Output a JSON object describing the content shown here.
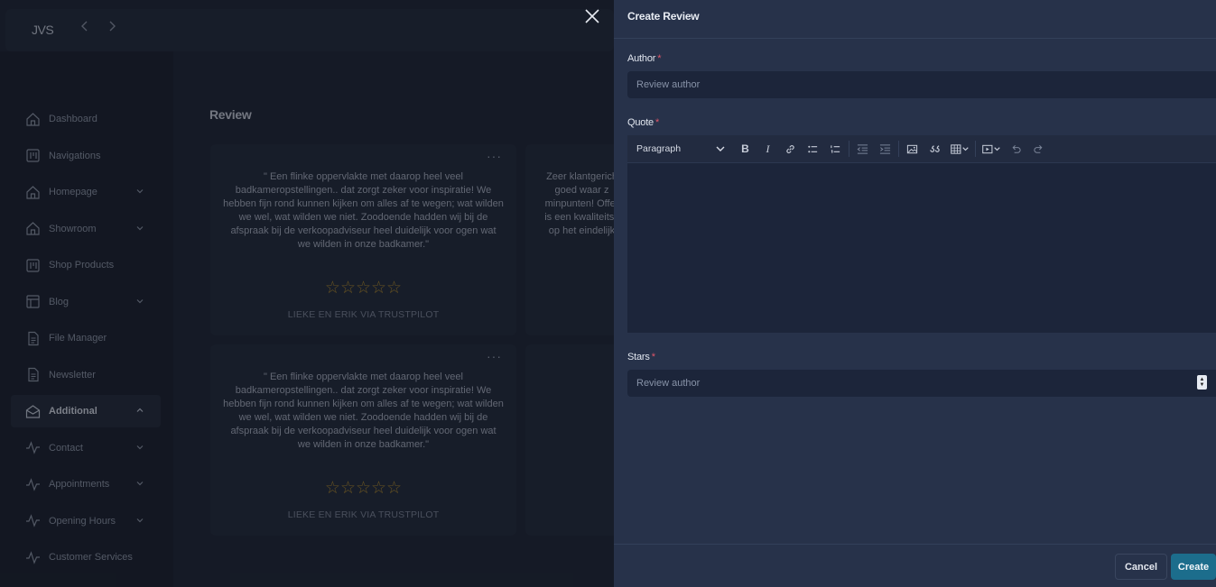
{
  "app": {
    "brand": "JVS",
    "page_title": "Review",
    "nav": [
      {
        "label": "Dashboard",
        "icon": "home-icon",
        "expandable": false
      },
      {
        "label": "Navigations",
        "icon": "nav-grid-icon",
        "expandable": false
      },
      {
        "label": "Homepage",
        "icon": "home-icon",
        "expandable": true
      },
      {
        "label": "Showroom",
        "icon": "home-icon",
        "expandable": true
      },
      {
        "label": "Shop Products",
        "icon": "nav-grid-icon",
        "expandable": false
      },
      {
        "label": "Blog",
        "icon": "layout-icon",
        "expandable": true
      },
      {
        "label": "File Manager",
        "icon": "file-icon",
        "expandable": false
      },
      {
        "label": "Newsletter",
        "icon": "file-icon",
        "expandable": false
      },
      {
        "label": "Additional",
        "icon": "mail-icon",
        "expandable": true,
        "active": true
      },
      {
        "label": "Contact",
        "icon": "activity-icon",
        "expandable": true
      },
      {
        "label": "Appointments",
        "icon": "activity-icon",
        "expandable": true
      },
      {
        "label": "Opening Hours",
        "icon": "activity-icon",
        "expandable": true
      },
      {
        "label": "Customer Services",
        "icon": "activity-icon",
        "expandable": false
      }
    ],
    "reviews": [
      {
        "quote": "\" Een flinke oppervlakte met daarop heel veel badkameropstellingen.. dat zorgt zeker voor inspiratie! We hebben fijn rond kunnen kijken om alles af te wegen; wat wilden we wel, wat wilden we niet. Zoodoende hadden wij bij de afspraak bij de verkoopadviseur heel duidelijk voor ogen wat we wilden in onze badkamer.\"",
        "stars": "☆☆☆☆☆",
        "byline": "LIEKE EN ERIK VIA TRUSTPILOT",
        "menu": "···"
      },
      {
        "quote": "Zeer klantgerich goed waar z minpunten! Offer is een kwaliteitsz op het eindelijk",
        "stars": "",
        "byline": "",
        "menu": ""
      },
      {
        "quote": "\" Een flinke oppervlakte met daarop heel veel badkameropstellingen.. dat zorgt zeker voor inspiratie! We hebben fijn rond kunnen kijken om alles af te wegen; wat wilden we wel, wat wilden we niet. Zoodoende hadden wij bij de afspraak bij de verkoopadviseur heel duidelijk voor ogen wat we wilden in onze badkamer.\"",
        "stars": "☆☆☆☆☆",
        "byline": "LIEKE EN ERIK VIA TRUSTPILOT",
        "menu": "···"
      }
    ]
  },
  "drawer": {
    "title": "Create Review",
    "author": {
      "label": "Author",
      "required_mark": "*",
      "placeholder": "Review author",
      "value": ""
    },
    "quote": {
      "label": "Quote",
      "required_mark": "*",
      "block_format": "Paragraph",
      "content": ""
    },
    "stars": {
      "label": "Stars",
      "required_mark": "*",
      "placeholder": "Review author",
      "value": ""
    },
    "cancel_label": "Cancel",
    "create_label": "Create"
  },
  "colors": {
    "accent": "#1c6d8c",
    "required": "#e0566a",
    "star": "#b48d2a",
    "drawer_bg": "#27324a",
    "input_bg": "#1c253a"
  }
}
